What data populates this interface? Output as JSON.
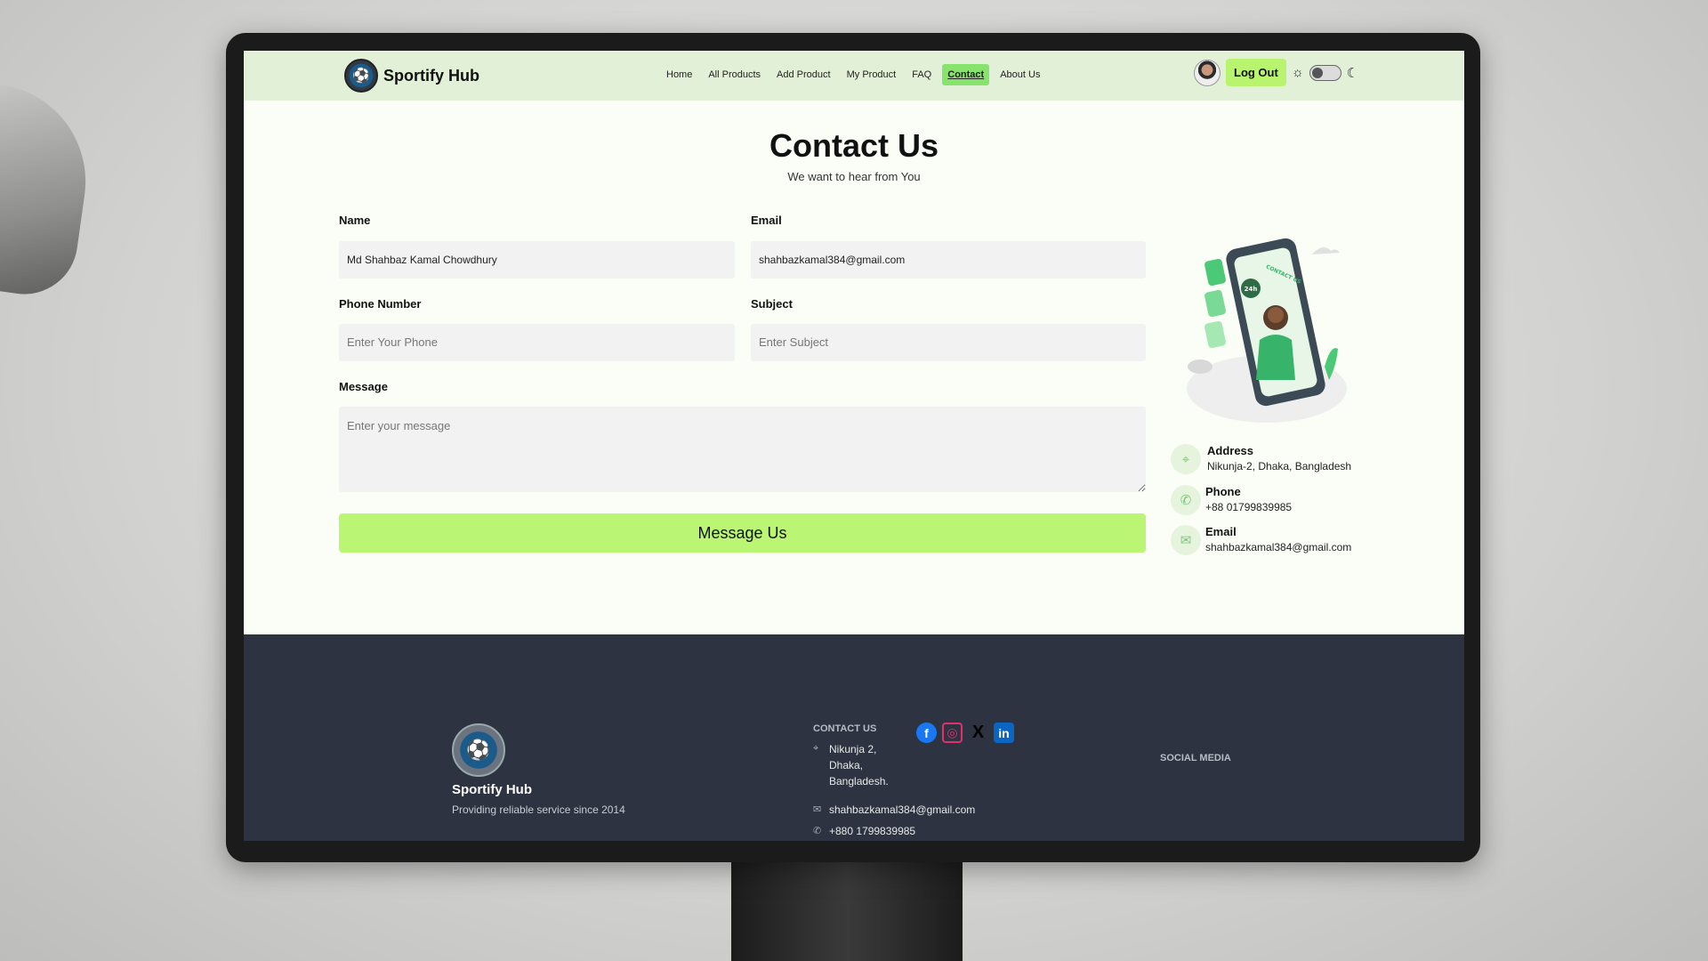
{
  "nav": {
    "brand": "Sportify Hub",
    "links": [
      {
        "label": "Home"
      },
      {
        "label": "All Products"
      },
      {
        "label": "Add Product"
      },
      {
        "label": "My Product"
      },
      {
        "label": "FAQ"
      },
      {
        "label": "Contact",
        "active": true
      },
      {
        "label": "About Us"
      }
    ],
    "logout": "Log Out"
  },
  "header": {
    "title": "Contact Us",
    "subtitle": "We want to hear from You"
  },
  "form": {
    "name_label": "Name",
    "name_value": "Md Shahbaz Kamal Chowdhury",
    "email_label": "Email",
    "email_value": "shahbazkamal384@gmail.com",
    "phone_label": "Phone Number",
    "phone_placeholder": "Enter Your Phone",
    "subject_label": "Subject",
    "subject_placeholder": "Enter Subject",
    "message_label": "Message",
    "message_placeholder": "Enter your message",
    "submit": "Message Us"
  },
  "illustration": {
    "badge": "24h",
    "sign": "CONTACT US"
  },
  "info": {
    "address_title": "Address",
    "address_value": "Nikunja-2, Dhaka, Bangladesh",
    "phone_title": "Phone",
    "phone_value": "+88 01799839985",
    "email_title": "Email",
    "email_value": "shahbazkamal384@gmail.com"
  },
  "footer": {
    "brand": "Sportify Hub",
    "tagline": "Providing reliable service since 2014",
    "contact_heading": "CONTACT US",
    "address_lines": [
      "Nikunja 2,",
      "Dhaka,",
      "Bangladesh."
    ],
    "email": "shahbazkamal384@gmail.com",
    "phone": "+880 1799839985",
    "social_heading": "SOCIAL MEDIA"
  },
  "colors": {
    "nav_bg": "#e2f0d7",
    "accent": "#baf574",
    "active_link": "#86e36b",
    "footer_bg": "#2d3340",
    "facebook": "#1877f2",
    "instagram": "#e1306c",
    "x": "#000000",
    "linkedin": "#0a66c2"
  },
  "icons": {
    "address": "map-pin-icon",
    "phone": "phone-icon",
    "email": "mail-icon",
    "theme_light": "sun-icon",
    "theme_dark": "moon-icon"
  }
}
